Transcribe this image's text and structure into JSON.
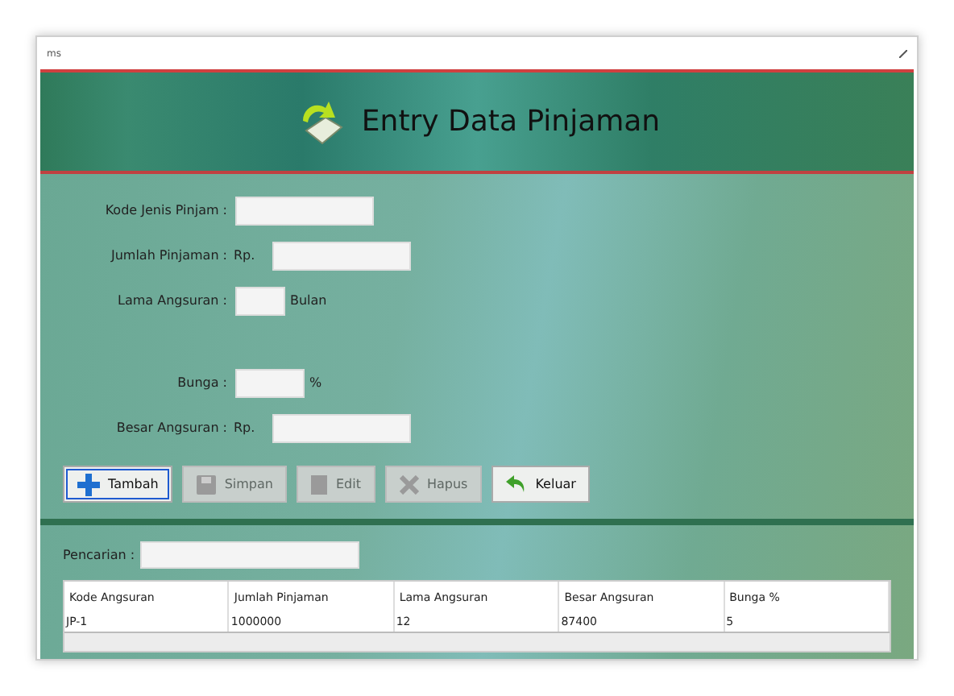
{
  "window": {
    "title": "ms"
  },
  "header": {
    "title": "Entry Data Pinjaman"
  },
  "form": [
    {
      "label": "Kode Jenis Pinjam :",
      "kind": "code"
    },
    {
      "label": "Jumlah Pinjaman :",
      "prefix": "Rp.",
      "kind": "amount"
    },
    {
      "label": "Lama Angsuran :",
      "suffix": "Bulan",
      "kind": "months"
    },
    {
      "label": "Bunga :",
      "suffix": "%",
      "kind": "percent"
    },
    {
      "label": "Besar Angsuran :",
      "prefix": "Rp.",
      "kind": "amount"
    }
  ],
  "buttons": [
    {
      "label": "Tambah",
      "kind": "plus",
      "disabled": false,
      "focused": true
    },
    {
      "label": "Simpan",
      "kind": "save",
      "disabled": true,
      "focused": false
    },
    {
      "label": "Edit",
      "kind": "edit",
      "disabled": true,
      "focused": false
    },
    {
      "label": "Hapus",
      "kind": "delete",
      "disabled": true,
      "focused": false
    },
    {
      "label": "Keluar",
      "kind": "back",
      "disabled": false,
      "focused": false
    }
  ],
  "search": {
    "label": "Pencarian :"
  },
  "table": {
    "columns": [
      "Kode Angsuran",
      "Jumlah Pinjaman",
      "Lama Angsuran",
      "Besar Angsuran",
      "Bunga %"
    ],
    "rows": [
      [
        "JP-1",
        "1000000",
        "12",
        "87400",
        "5"
      ]
    ]
  }
}
